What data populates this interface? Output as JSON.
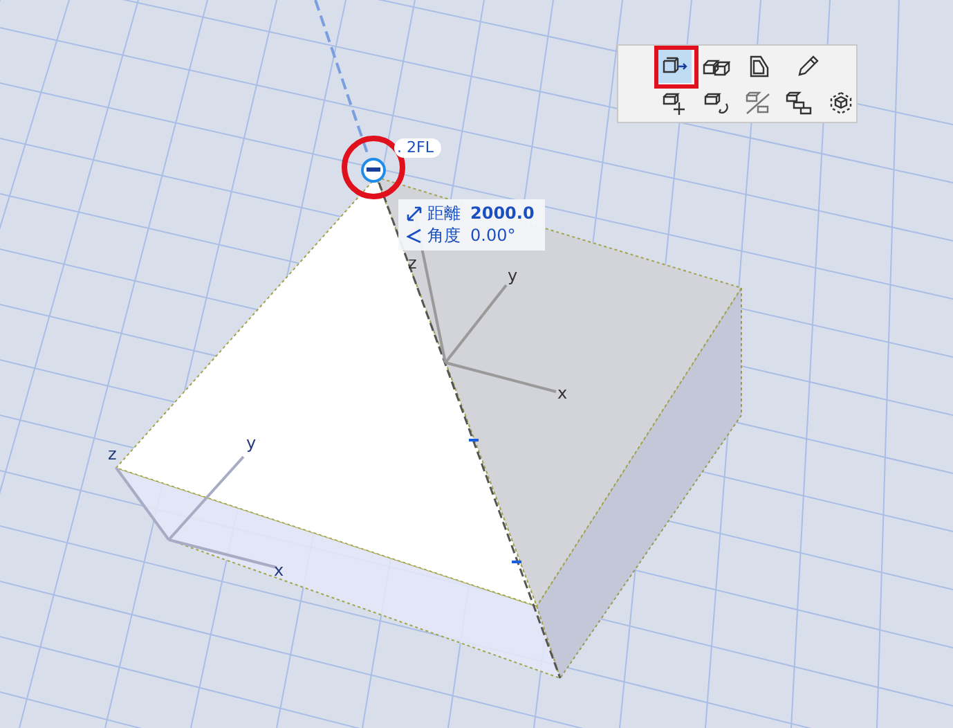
{
  "level_tag": {
    "label": ". 2FL"
  },
  "measure_tooltip": {
    "rows": [
      {
        "kind": "distance",
        "label": "距離",
        "value": "2000.0"
      },
      {
        "kind": "angle",
        "label": "角度",
        "value": "0.00°"
      }
    ]
  },
  "gizmos": [
    {
      "labels": [
        "z",
        "y",
        "x"
      ]
    },
    {
      "labels": [
        "z",
        "y",
        "x"
      ]
    }
  ],
  "toolbar": {
    "tools": [
      {
        "selected": true
      },
      {
        "selected": false
      },
      {
        "selected": false
      },
      {
        "selected": false
      },
      {
        "selected": false
      },
      {
        "selected": false
      },
      {
        "selected": false
      },
      {
        "selected": false
      },
      {
        "selected": false
      }
    ]
  }
}
